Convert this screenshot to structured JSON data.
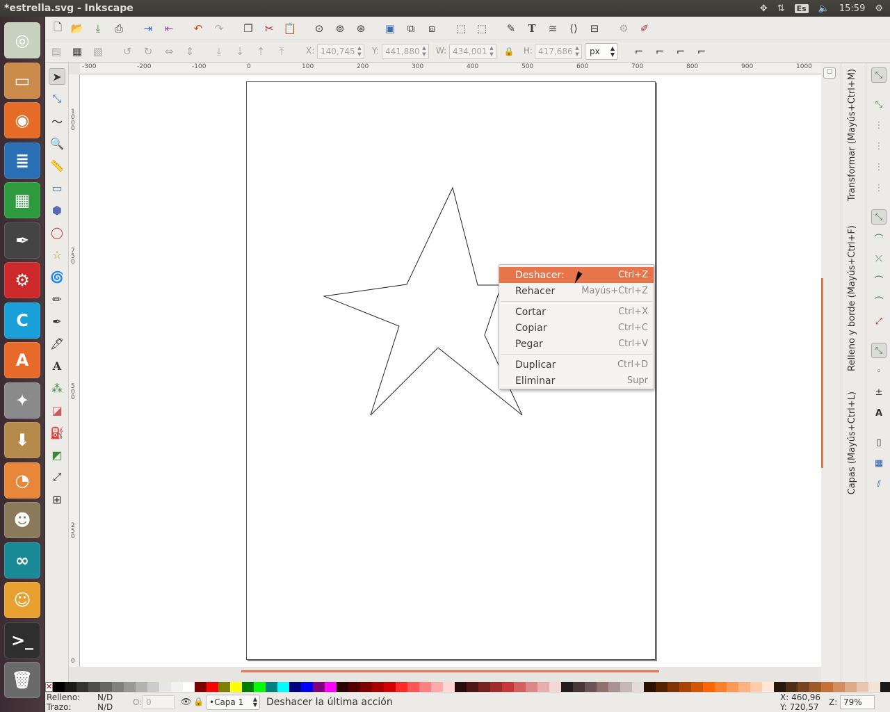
{
  "window": {
    "title": "*estrella.svg - Inkscape"
  },
  "topbar": {
    "lang": "Es",
    "clock": "15:59"
  },
  "launcher": {
    "items": [
      {
        "name": "dash-icon",
        "glyph": "◎",
        "color": "#c8d0c0"
      },
      {
        "name": "files-icon",
        "glyph": "▭",
        "color": "#c98a4a"
      },
      {
        "name": "firefox-icon",
        "glyph": "◉",
        "color": "#e66b26"
      },
      {
        "name": "writer-icon",
        "glyph": "≣",
        "color": "#2a6fb5"
      },
      {
        "name": "calc-icon",
        "glyph": "▦",
        "color": "#2e9a3e"
      },
      {
        "name": "inkscape-icon",
        "glyph": "✒",
        "color": "#444444"
      },
      {
        "name": "freecad-icon",
        "glyph": "⚙",
        "color": "#cc2a2a"
      },
      {
        "name": "c-app-icon",
        "glyph": "C",
        "color": "#1aa0d8"
      },
      {
        "name": "software-center-icon",
        "glyph": "A",
        "color": "#e86a2a"
      },
      {
        "name": "system-settings-icon",
        "glyph": "✦",
        "color": "#8a8a8a"
      },
      {
        "name": "archive-icon",
        "glyph": "⬇",
        "color": "#b58a4a"
      },
      {
        "name": "blender-icon",
        "glyph": "◔",
        "color": "#e8873a"
      },
      {
        "name": "gimp-icon",
        "glyph": "☻",
        "color": "#8a7a5a"
      },
      {
        "name": "arduino-icon",
        "glyph": "∞",
        "color": "#1a8a96"
      },
      {
        "name": "scratch-icon",
        "glyph": "☺",
        "color": "#e8a030"
      },
      {
        "name": "terminal-icon",
        "glyph": ">_",
        "color": "#2e2e2e"
      },
      {
        "name": "trash-icon",
        "glyph": "🗑",
        "color": "#6a6a6a"
      }
    ]
  },
  "controls": {
    "x_label": "X:",
    "x_value": "140,745",
    "y_label": "Y:",
    "y_value": "441,880",
    "w_label": "W:",
    "w_value": "434,001",
    "h_label": "H:",
    "h_value": "417,686",
    "unit": "px"
  },
  "ruler": {
    "h_ticks": [
      "-300",
      "-200",
      "-100",
      "0",
      "100",
      "200",
      "300",
      "400",
      "500",
      "600",
      "700",
      "800",
      "900",
      "1000"
    ],
    "v_ticks": [
      "1\n0\n0\n0",
      "7\n5\n0",
      "5\n0\n0",
      "2\n5\n0",
      "0"
    ]
  },
  "context_menu": {
    "items": [
      {
        "label": "Deshacer:",
        "shortcut": "Ctrl+Z",
        "highlight": true
      },
      {
        "label": "Rehacer",
        "shortcut": "Mayús+Ctrl+Z"
      },
      {
        "sep": true
      },
      {
        "label": "Cortar",
        "shortcut": "Ctrl+X"
      },
      {
        "label": "Copiar",
        "shortcut": "Ctrl+C"
      },
      {
        "label": "Pegar",
        "shortcut": "Ctrl+V"
      },
      {
        "sep": true
      },
      {
        "label": "Duplicar",
        "shortcut": "Ctrl+D"
      },
      {
        "label": "Eliminar",
        "shortcut": "Supr"
      }
    ]
  },
  "dock": {
    "transform_tab": "Transformar (Mayús+Ctrl+M)",
    "fill_tab": "Relleno y borde (Mayús+Ctrl+F)",
    "layers_tab": "Capas (Mayús+Ctrl+L)"
  },
  "palette": {
    "colors": [
      "#000000",
      "#1a1a1a",
      "#333333",
      "#4d4d4d",
      "#666666",
      "#808080",
      "#999999",
      "#b3b3b3",
      "#cccccc",
      "#e6e6e6",
      "#f2f2f2",
      "#ffffff",
      "#800000",
      "#ff0000",
      "#808000",
      "#ffff00",
      "#008000",
      "#00ff00",
      "#008080",
      "#00ffff",
      "#000080",
      "#0000ff",
      "#800080",
      "#ff00ff",
      "#2b0000",
      "#550000",
      "#800000",
      "#aa0000",
      "#d40000",
      "#ff2a2a",
      "#ff5555",
      "#ff8080",
      "#ffaaaa",
      "#ffd5d5",
      "#280b0b",
      "#501616",
      "#782121",
      "#a02c2c",
      "#c83737",
      "#d35f5f",
      "#de8787",
      "#e9afaf",
      "#f4d7d7",
      "#241c1c",
      "#483737",
      "#6c5353",
      "#916f6f",
      "#ac9393",
      "#c8b7b7",
      "#e3dbdb",
      "#2b1100",
      "#552200",
      "#803300",
      "#aa4400",
      "#d45500",
      "#ff6600",
      "#ff7f2a",
      "#ff9955",
      "#ffb380",
      "#ffccaa",
      "#ffe6d5",
      "#28170b",
      "#502d16",
      "#784421",
      "#a05a2c",
      "#c87137",
      "#d38d5f",
      "#deaa87",
      "#e9c6af",
      "#f4e3d7",
      "#1a1a1a"
    ]
  },
  "status": {
    "fill_label": "Relleno:",
    "fill_value": "N/D",
    "stroke_label": "Trazo:",
    "stroke_value": "N/D",
    "opacity_label": "O:",
    "opacity_value": "0",
    "layer": "•Capa 1",
    "message": "Deshacer la última acción",
    "x_coord": "X:  460,96",
    "y_coord": "Y:  720,57",
    "zoom_label": "Z:",
    "zoom_value": "79%"
  }
}
